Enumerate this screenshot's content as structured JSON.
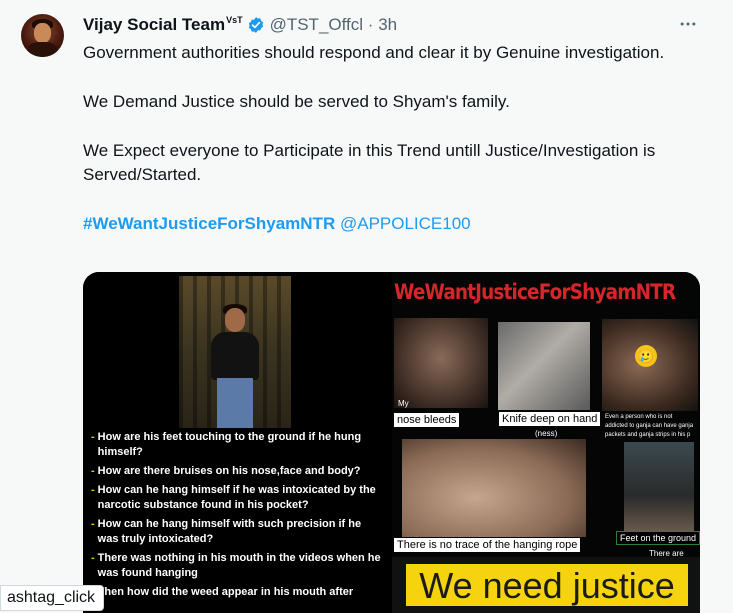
{
  "tweet": {
    "author_name": "Vijay Social Team",
    "author_suffix": "VsT",
    "handle": "@TST_Offcl",
    "separator": "·",
    "time": "3h",
    "more_icon": "more-icon",
    "verified_icon": "verified-badge-icon",
    "paragraphs": [
      "Government authorities should respond and clear it by Genuine investigation.",
      "We Demand Justice should be served to Shyam's family.",
      "We Expect everyone to Participate in this Trend untill Justice/Investigation is Served/Started."
    ],
    "hashtag": "#WeWantJusticeForShyamNTR",
    "mention": "@APPOLICE100"
  },
  "media": {
    "left_questions": [
      "How are his feet touching to the ground if he hung himself?",
      "How are there bruises on his nose,face and body?",
      "How can he hang himself if he was intoxicated by the narcotic substance found in his pocket?",
      "How can he hang himself with such precision if he was truly intoxicated?",
      "There was nothing in his mouth in the videos when he was found hanging",
      "Then how did the weed appear in his mouth after"
    ],
    "right_title": "WeWantJusticeForShyamNTR",
    "captions": {
      "nose": "nose bleeds",
      "nose_prefix": "My",
      "knife": "Knife deep on hand",
      "knife_sub": "(ness)",
      "addict": "Even a person who is not addicted to ganja can have ganja packets and ganja strips in his p",
      "rope": "There is no trace of the hanging rope",
      "feet": "Feet on the ground",
      "feet_sub": "There are"
    },
    "emoji": "🥲",
    "banner": "We need justice"
  },
  "toast": {
    "text": "ashtag_click"
  },
  "colors": {
    "link": "#1d9bf0",
    "banner_bg": "#f5d40f",
    "title_red": "#d7262b"
  }
}
